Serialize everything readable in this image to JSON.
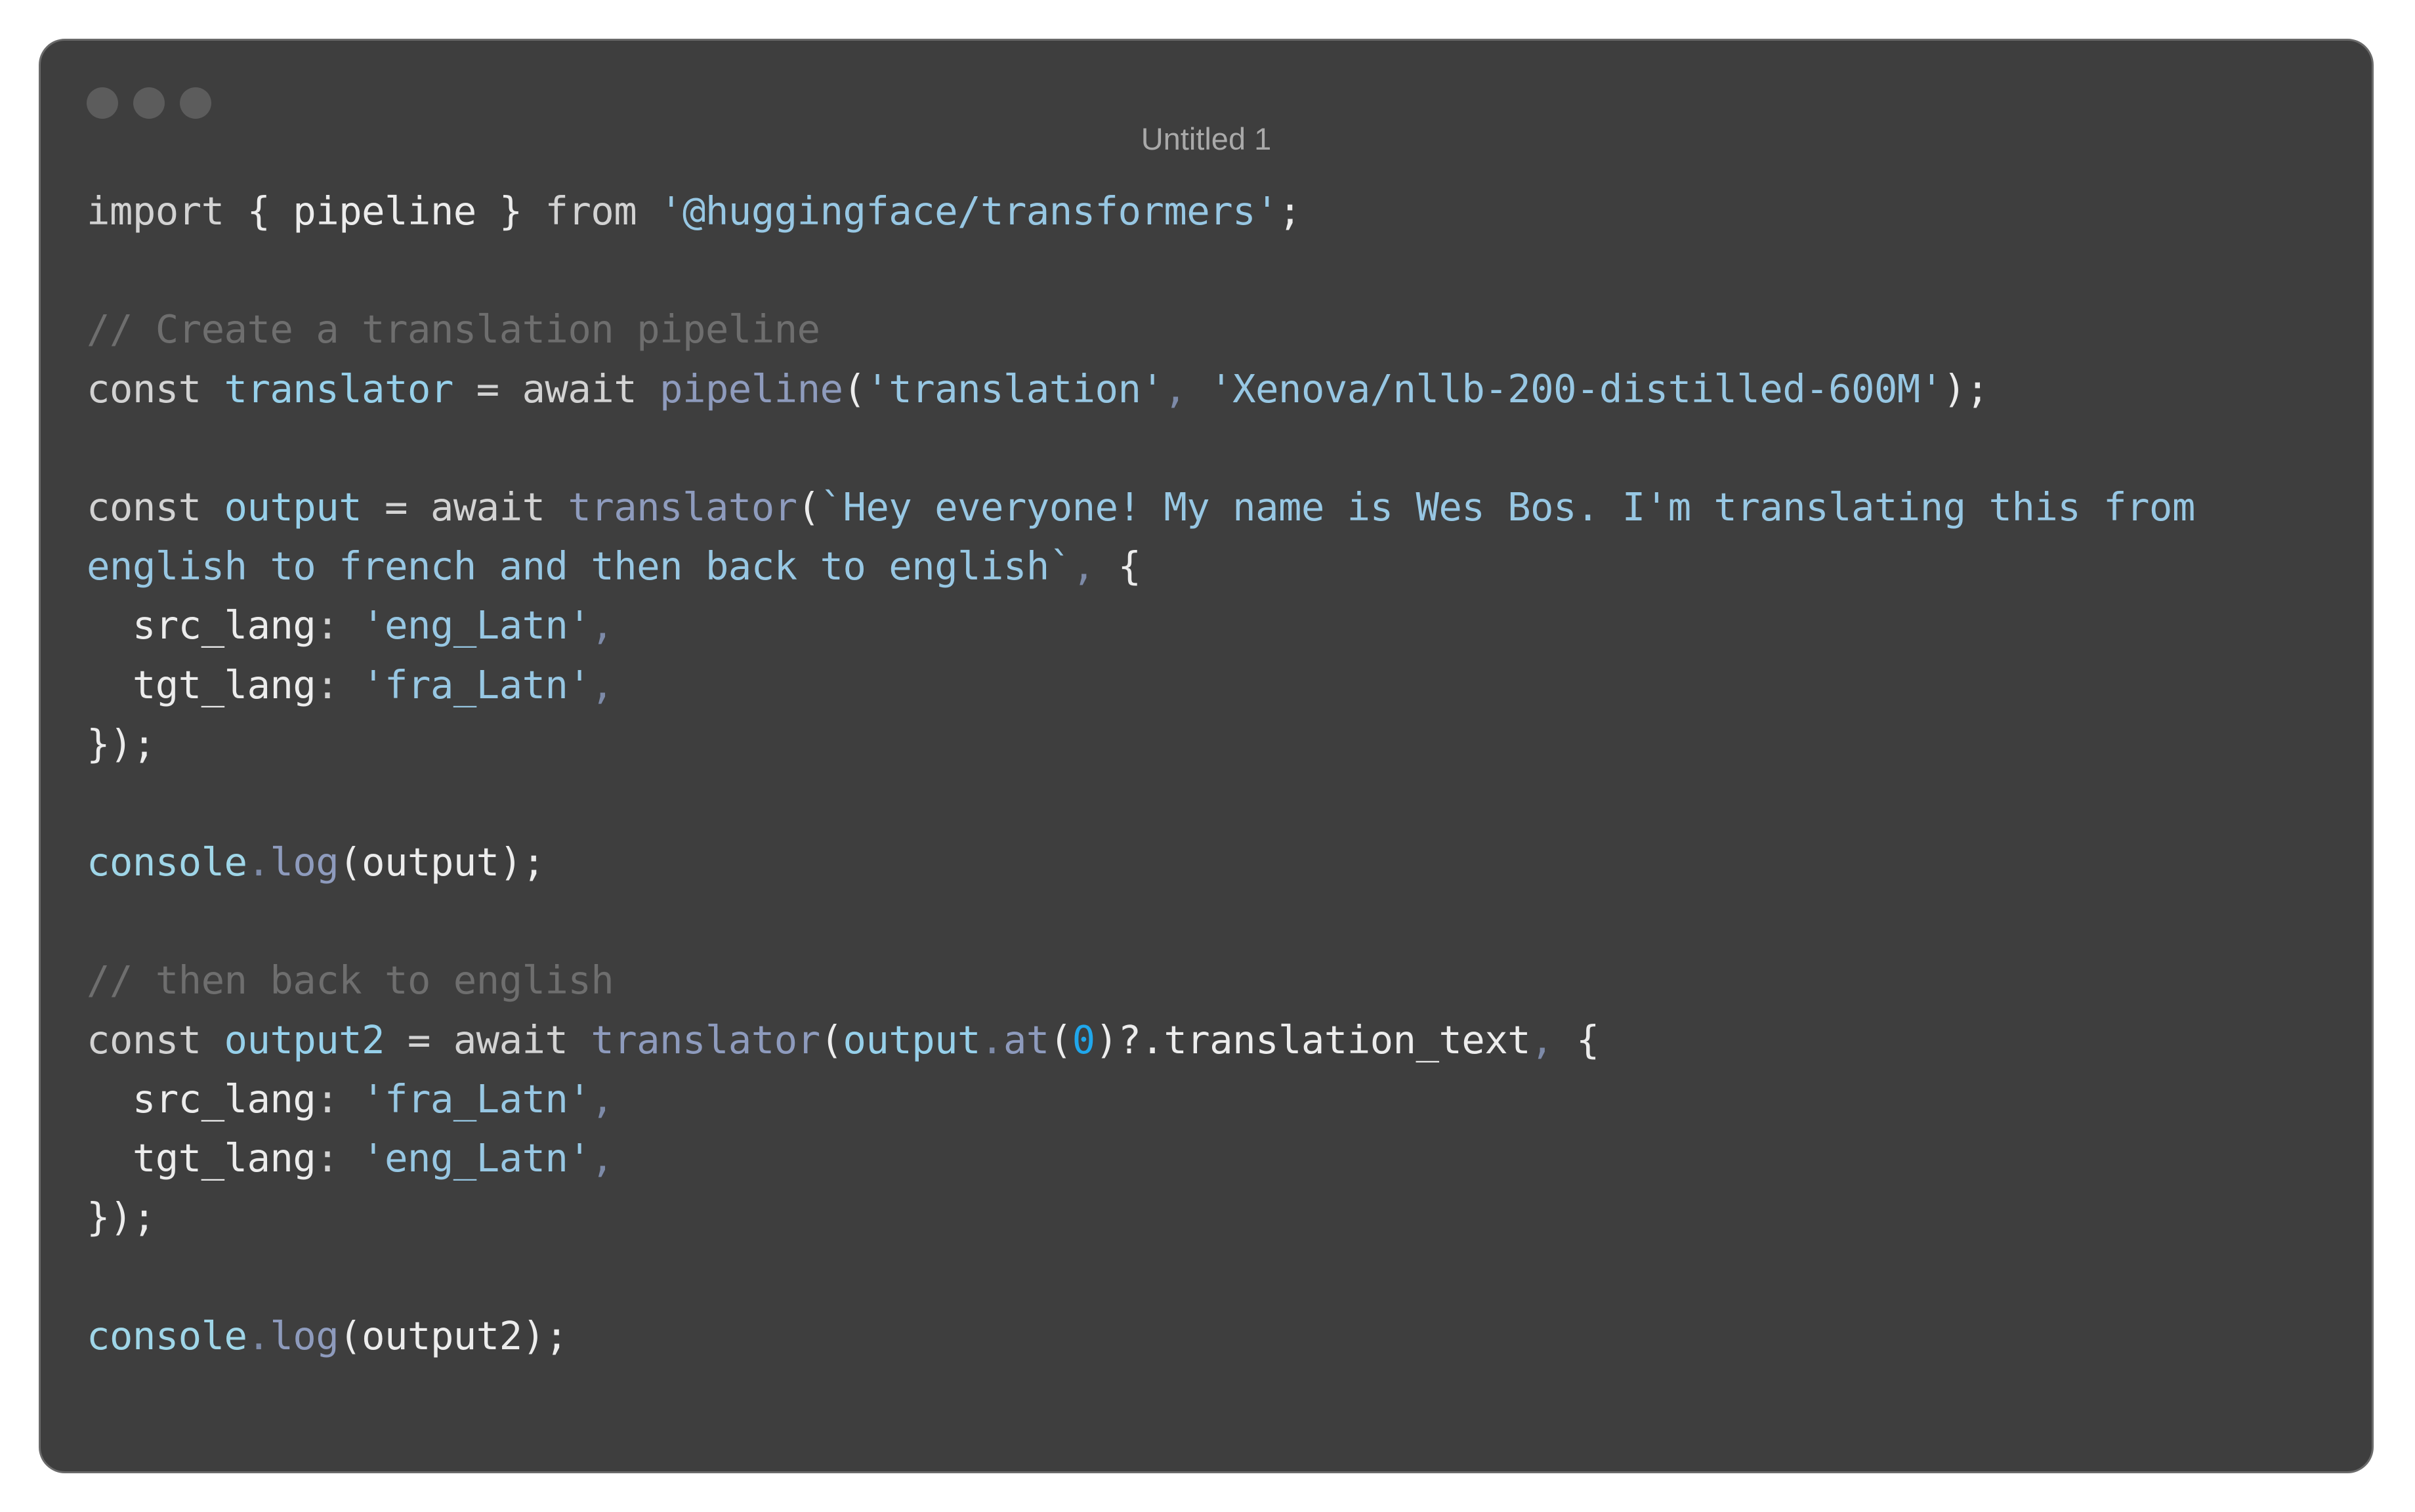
{
  "window": {
    "title": "Untitled 1",
    "controls": [
      "close",
      "minimize",
      "zoom"
    ]
  },
  "code": {
    "language": "javascript",
    "lines": [
      [
        {
          "t": "import",
          "k": "kw"
        },
        {
          "t": " { ",
          "k": "pun"
        },
        {
          "t": "pipeline",
          "k": "txt"
        },
        {
          "t": " } ",
          "k": "pun"
        },
        {
          "t": "from",
          "k": "kw"
        },
        {
          "t": " ",
          "k": "pun"
        },
        {
          "t": "'@huggingface/transformers'",
          "k": "str"
        },
        {
          "t": ";",
          "k": "pun"
        }
      ],
      [],
      [
        {
          "t": "// Create a translation pipeline",
          "k": "com"
        }
      ],
      [
        {
          "t": "const",
          "k": "kw"
        },
        {
          "t": " ",
          "k": "pun"
        },
        {
          "t": "translator",
          "k": "var"
        },
        {
          "t": " = ",
          "k": "kw"
        },
        {
          "t": "await",
          "k": "kw"
        },
        {
          "t": " ",
          "k": "pun"
        },
        {
          "t": "pipeline",
          "k": "fn"
        },
        {
          "t": "(",
          "k": "pun"
        },
        {
          "t": "'translation'",
          "k": "str"
        },
        {
          "t": ", ",
          "k": "dim"
        },
        {
          "t": "'Xenova/nllb-200-distilled-600M'",
          "k": "str"
        },
        {
          "t": ");",
          "k": "pun"
        }
      ],
      [],
      [
        {
          "t": "const",
          "k": "kw"
        },
        {
          "t": " ",
          "k": "pun"
        },
        {
          "t": "output",
          "k": "var"
        },
        {
          "t": " = ",
          "k": "kw"
        },
        {
          "t": "await",
          "k": "kw"
        },
        {
          "t": " ",
          "k": "pun"
        },
        {
          "t": "translator",
          "k": "fn"
        },
        {
          "t": "(",
          "k": "pun"
        },
        {
          "t": "`Hey everyone! My name is Wes Bos. I'm translating this from",
          "k": "str"
        }
      ],
      [
        {
          "t": "english to french and then back to english`",
          "k": "str"
        },
        {
          "t": ", ",
          "k": "dim"
        },
        {
          "t": "{",
          "k": "pun"
        }
      ],
      [
        {
          "t": "  src_lang",
          "k": "txt"
        },
        {
          "t": ": ",
          "k": "kw"
        },
        {
          "t": "'eng_Latn'",
          "k": "str"
        },
        {
          "t": ",",
          "k": "dim"
        }
      ],
      [
        {
          "t": "  tgt_lang",
          "k": "txt"
        },
        {
          "t": ": ",
          "k": "kw"
        },
        {
          "t": "'fra_Latn'",
          "k": "str"
        },
        {
          "t": ",",
          "k": "dim"
        }
      ],
      [
        {
          "t": "});",
          "k": "pun"
        }
      ],
      [],
      [
        {
          "t": "console",
          "k": "obj"
        },
        {
          "t": ".",
          "k": "dim"
        },
        {
          "t": "log",
          "k": "fn"
        },
        {
          "t": "(output);",
          "k": "pun"
        }
      ],
      [],
      [
        {
          "t": "// then back to english",
          "k": "com"
        }
      ],
      [
        {
          "t": "const",
          "k": "kw"
        },
        {
          "t": " ",
          "k": "pun"
        },
        {
          "t": "output2",
          "k": "var"
        },
        {
          "t": " = ",
          "k": "kw"
        },
        {
          "t": "await",
          "k": "kw"
        },
        {
          "t": " ",
          "k": "pun"
        },
        {
          "t": "translator",
          "k": "fn"
        },
        {
          "t": "(",
          "k": "pun"
        },
        {
          "t": "output",
          "k": "var"
        },
        {
          "t": ".",
          "k": "dim"
        },
        {
          "t": "at",
          "k": "fn"
        },
        {
          "t": "(",
          "k": "pun"
        },
        {
          "t": "0",
          "k": "num"
        },
        {
          "t": ")?.translation_text",
          "k": "pun"
        },
        {
          "t": ", ",
          "k": "dim"
        },
        {
          "t": "{",
          "k": "pun"
        }
      ],
      [
        {
          "t": "  src_lang",
          "k": "txt"
        },
        {
          "t": ": ",
          "k": "kw"
        },
        {
          "t": "'fra_Latn'",
          "k": "str"
        },
        {
          "t": ",",
          "k": "dim"
        }
      ],
      [
        {
          "t": "  tgt_lang",
          "k": "txt"
        },
        {
          "t": ": ",
          "k": "kw"
        },
        {
          "t": "'eng_Latn'",
          "k": "str"
        },
        {
          "t": ",",
          "k": "dim"
        }
      ],
      [
        {
          "t": "});",
          "k": "pun"
        }
      ],
      [],
      [
        {
          "t": "console",
          "k": "obj"
        },
        {
          "t": ".",
          "k": "dim"
        },
        {
          "t": "log",
          "k": "fn"
        },
        {
          "t": "(output2);",
          "k": "pun"
        }
      ]
    ]
  }
}
